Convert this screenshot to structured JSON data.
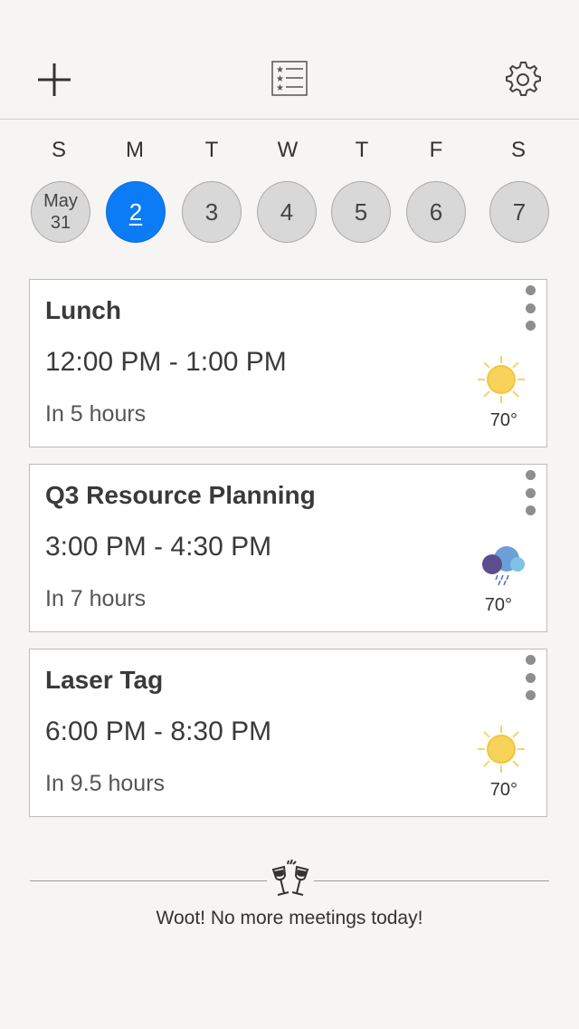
{
  "toolbar": {
    "add_icon": "plus-icon",
    "list_icon": "starred-list-icon",
    "settings_icon": "gear-icon"
  },
  "week": {
    "days": [
      {
        "weekday": "S",
        "month": "May",
        "date": "31"
      },
      {
        "weekday": "M",
        "date": "2",
        "selected": true
      },
      {
        "weekday": "T",
        "date": "3"
      },
      {
        "weekday": "W",
        "date": "4"
      },
      {
        "weekday": "T",
        "date": "5"
      },
      {
        "weekday": "F",
        "date": "6"
      },
      {
        "weekday": "S",
        "date": "7"
      }
    ]
  },
  "events": [
    {
      "title": "Lunch",
      "time": "12:00 PM - 1:00 PM",
      "relative": "In 5 hours",
      "weather_icon": "sun-icon",
      "temp": "70°"
    },
    {
      "title": "Q3 Resource Planning",
      "time": "3:00 PM - 4:30 PM",
      "relative": "In 7 hours",
      "weather_icon": "rain-cloud-icon",
      "temp": "70°"
    },
    {
      "title": "Laser Tag",
      "time": "6:00 PM - 8:30 PM",
      "relative": "In 9.5 hours",
      "weather_icon": "sun-icon",
      "temp": "70°"
    }
  ],
  "footer": {
    "icon": "cheers-glasses-icon",
    "message": "Woot! No more meetings today!"
  },
  "colors": {
    "accent": "#0b7cf5",
    "background": "#f6f5f3",
    "sun": "#f7d35a",
    "rain_cloud": "#5b7fb6"
  }
}
